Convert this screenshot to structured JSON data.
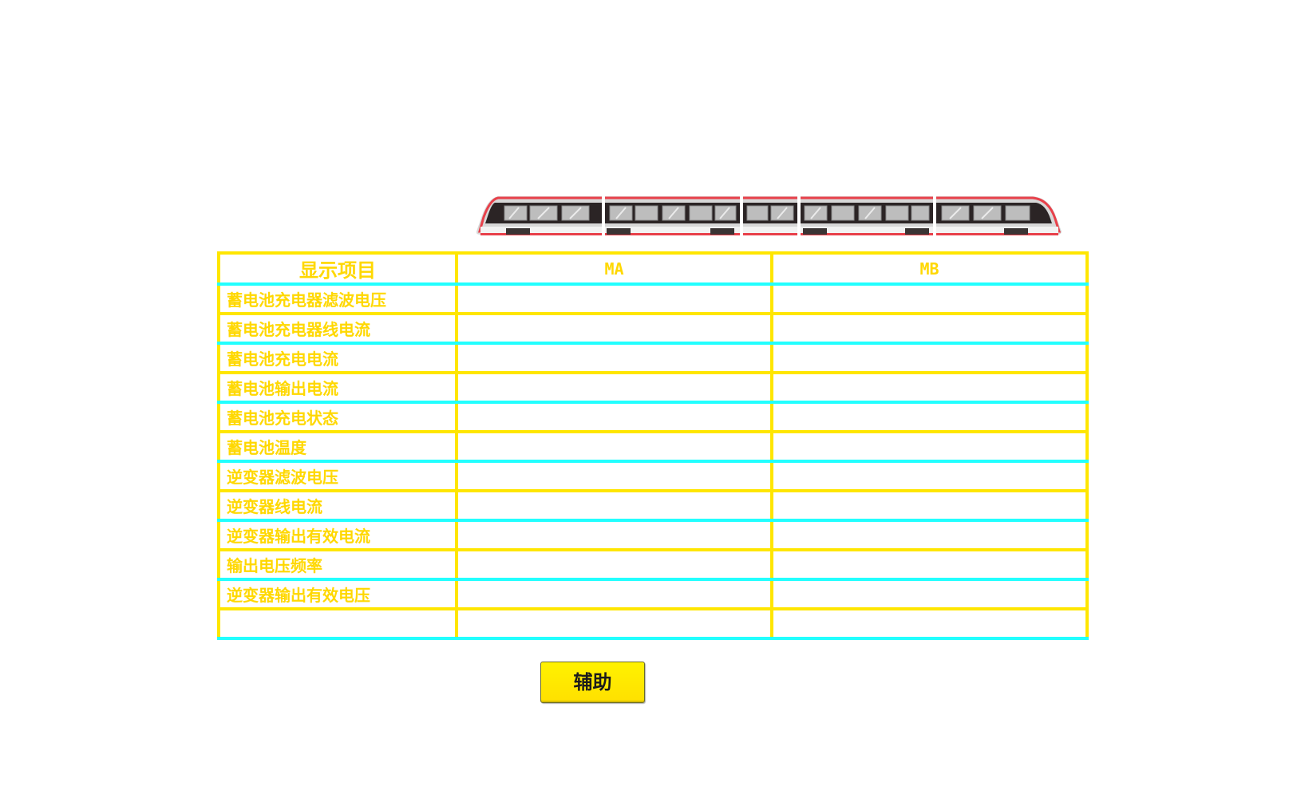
{
  "table": {
    "header": {
      "label": "显示项目",
      "columns": [
        "MA",
        "MB"
      ]
    },
    "rows": [
      {
        "label": "蓄电池充电器滤波电压",
        "values": [
          "",
          ""
        ]
      },
      {
        "label": "蓄电池充电器线电流",
        "values": [
          "",
          ""
        ]
      },
      {
        "label": "蓄电池充电电流",
        "values": [
          "",
          ""
        ]
      },
      {
        "label": "蓄电池输出电流",
        "values": [
          "",
          ""
        ]
      },
      {
        "label": "蓄电池充电状态",
        "values": [
          "",
          ""
        ]
      },
      {
        "label": "蓄电池温度",
        "values": [
          "",
          ""
        ]
      },
      {
        "label": "逆变器滤波电压",
        "values": [
          "",
          ""
        ]
      },
      {
        "label": "逆变器线电流",
        "values": [
          "",
          ""
        ]
      },
      {
        "label": "逆变器输出有效电流",
        "values": [
          "",
          ""
        ]
      },
      {
        "label": "输出电压频率",
        "values": [
          "",
          ""
        ]
      },
      {
        "label": "逆变器输出有效电压",
        "values": [
          "",
          ""
        ]
      },
      {
        "label": "",
        "values": [
          "",
          ""
        ]
      }
    ]
  },
  "aux_button": {
    "label": "辅助"
  },
  "icons": {
    "train": "train-icon"
  },
  "colors": {
    "table_border": "#ffe600",
    "table_border_alt": "#22ffff",
    "label_text": "#ffd800",
    "button_fill": "#fff000",
    "train_accent": "#e8404a"
  }
}
